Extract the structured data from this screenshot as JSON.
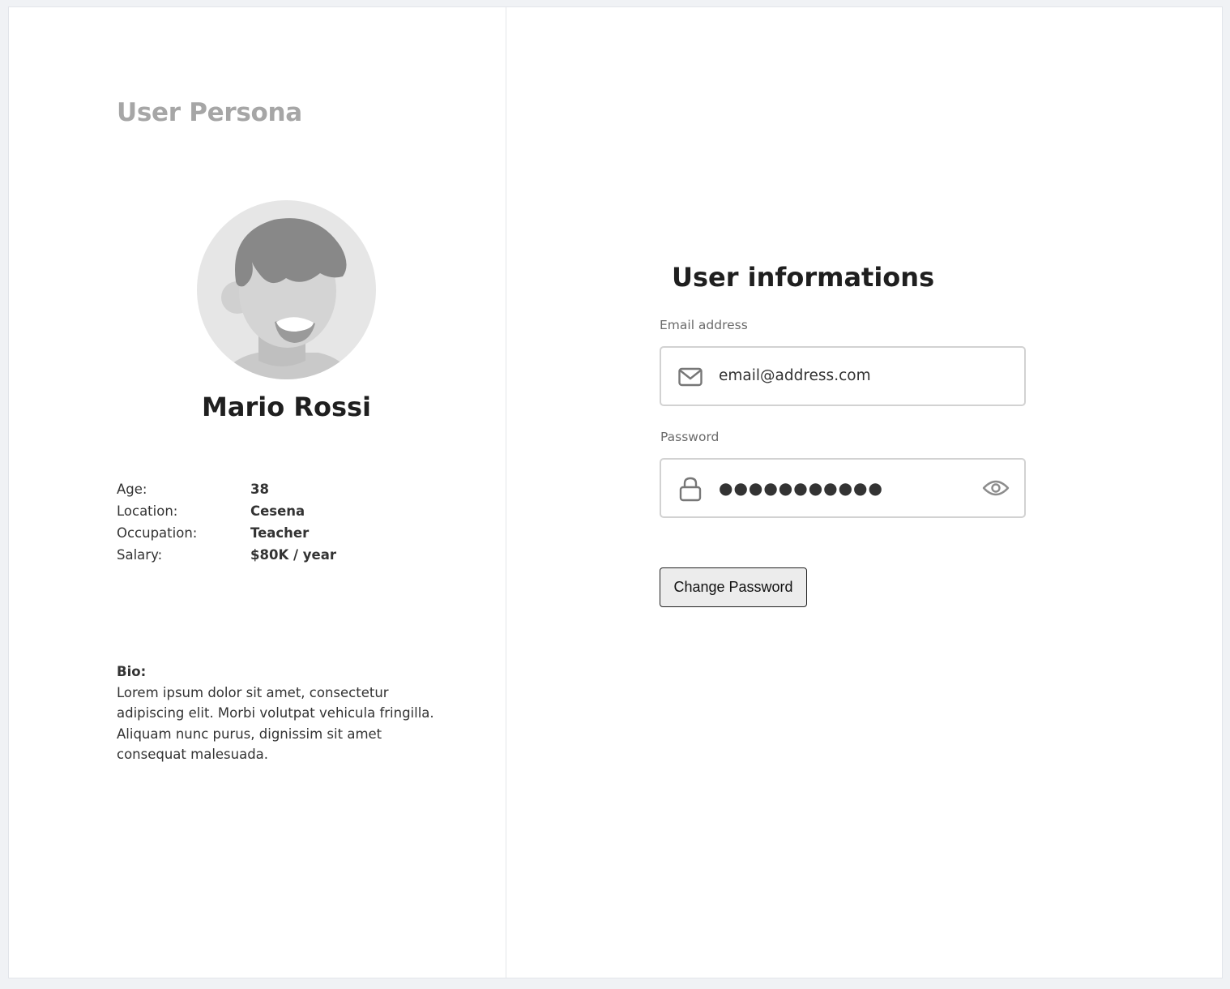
{
  "persona": {
    "heading": "User Persona",
    "name": "Mario Rossi",
    "details": [
      {
        "label": "Age:",
        "value": "38"
      },
      {
        "label": "Location:",
        "value": "Cesena"
      },
      {
        "label": "Occupation:",
        "value": "Teacher"
      },
      {
        "label": "Salary:",
        "value": "$80K / year"
      }
    ],
    "bio": {
      "label": "Bio:",
      "text": "Lorem ipsum dolor sit amet, consectetur adipiscing elit. Morbi volutpat vehicula fringilla. Aliquam nunc purus, dignissim sit amet consequat malesuada."
    }
  },
  "user_info": {
    "heading": "User informations",
    "email": {
      "label": "Email address",
      "value": "email@address.com",
      "icon": "envelope-icon"
    },
    "password": {
      "label": "Password",
      "value": "●●●●●●●●●●●",
      "icon": "lock-icon",
      "toggle_icon": "eye-icon"
    },
    "change_password_label": "Change Password"
  },
  "colors": {
    "page_background": "#f0f2f5",
    "panel_background": "#ffffff",
    "heading_muted": "#a6a6a6",
    "heading_dark": "#1f1f1f",
    "text": "#333333",
    "label": "#6b6b6b",
    "field_border": "#d2d2d2",
    "icon": "#777777",
    "avatar_background": "#e6e6e6",
    "avatar_hair": "#888888",
    "avatar_skin": "#d4d4d4"
  }
}
